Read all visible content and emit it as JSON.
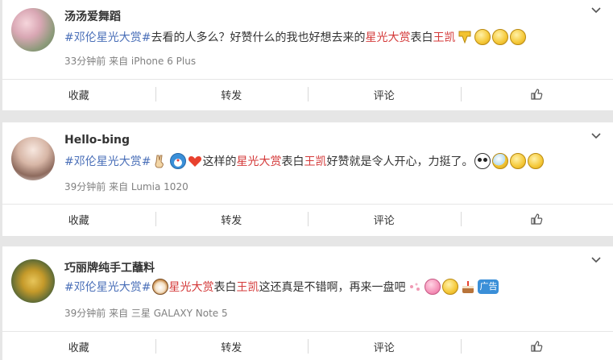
{
  "posts": [
    {
      "name": "汤汤爱舞蹈",
      "text": {
        "tag": "#邓伦星光大赏#",
        "p1": "去看的人多么？好赞什么的我也好想去来的",
        "hl1": "星光大赏",
        "p2": "表白",
        "hl2": "王凯"
      },
      "emoji": [
        "down-arrow-sticker-icon",
        "surprised-face-icon",
        "surprised-face-icon",
        "angry-face-icon"
      ],
      "meta": "33分钟前 来自 iPhone 6 Plus",
      "actions": {
        "fav": "收藏",
        "repost": "转发",
        "comment": "评论"
      }
    },
    {
      "name": "Hello-bing",
      "text": {
        "tag": "#邓伦星光大赏#",
        "p1": "这样的",
        "hl1": "星光大赏",
        "p2": "表白",
        "hl2": "王凯",
        "p3": "好赞就是令人开心，力挺了。"
      },
      "emoji": [
        "victory-hand-icon",
        "doraemon-icon",
        "heart-icon",
        "panda-icon",
        "sweat-face-icon",
        "thinking-face-icon",
        "laughing-face-icon"
      ],
      "meta": "39分钟前 来自 Lumia 1020",
      "actions": {
        "fav": "收藏",
        "repost": "转发",
        "comment": "评论"
      }
    },
    {
      "name": "巧丽牌纯手工蘸料",
      "text": {
        "tag": "#邓伦星光大赏#",
        "hl1": "星光大赏",
        "p2": "表白",
        "hl2": "王凯",
        "p3": "这还真是不错啊，再来一盘吧"
      },
      "emoji": [
        "dog-face-icon",
        "sparkle-icon",
        "pink-pig-icon",
        "crying-face-icon",
        "cake-icon",
        "ad-badge-icon"
      ],
      "ad_label": "广告",
      "meta": "39分钟前 来自 三星 GALAXY Note 5",
      "actions": {
        "fav": "收藏",
        "repost": "转发",
        "comment": "评论"
      }
    }
  ],
  "colors": {
    "hashtag": "#4a6fb8",
    "highlight": "#d43a3a",
    "meta": "#808080",
    "background": "#e6e6e6"
  }
}
